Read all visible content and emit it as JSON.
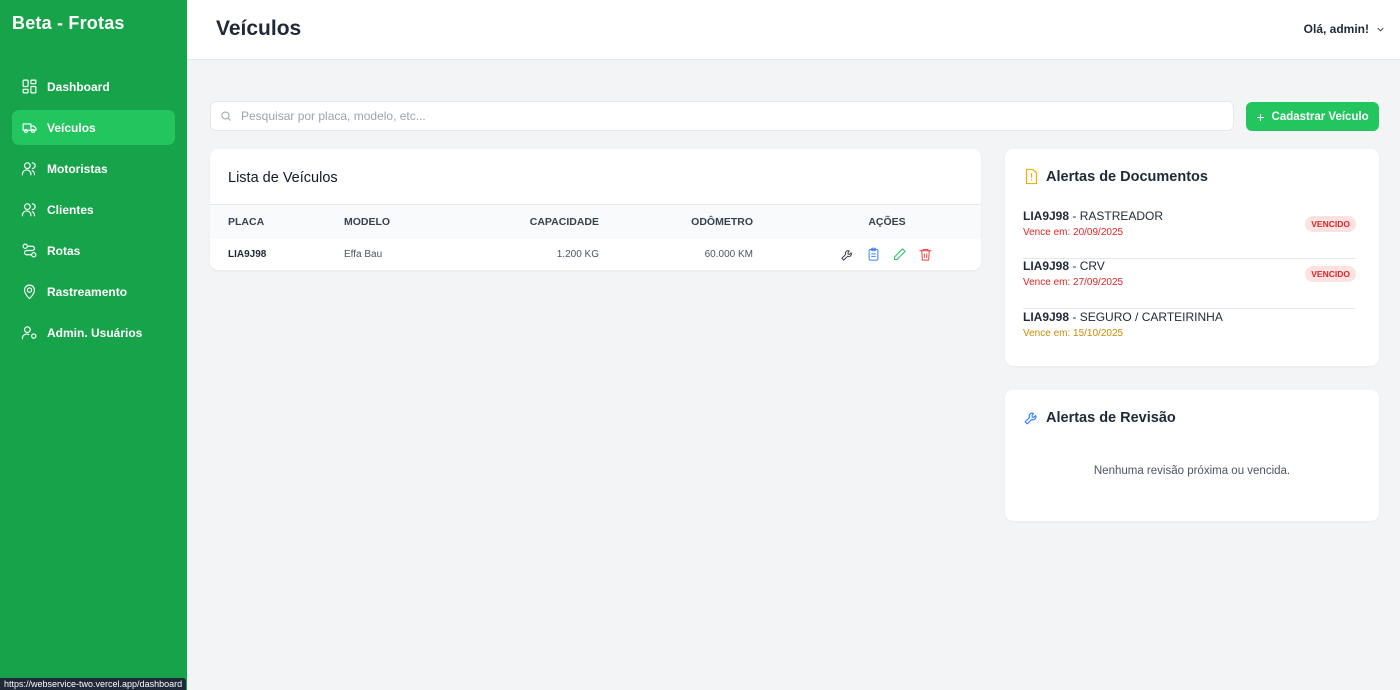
{
  "brand": "Beta - Frotas",
  "sidebar": {
    "items": [
      {
        "label": "Dashboard",
        "icon": "dashboard-icon"
      },
      {
        "label": "Veículos",
        "icon": "truck-icon",
        "active": true
      },
      {
        "label": "Motoristas",
        "icon": "users-icon"
      },
      {
        "label": "Clientes",
        "icon": "users-icon"
      },
      {
        "label": "Rotas",
        "icon": "route-icon"
      },
      {
        "label": "Rastreamento",
        "icon": "map-pin-icon"
      },
      {
        "label": "Admin. Usuários",
        "icon": "user-cog-icon"
      }
    ]
  },
  "status_url": "https://webservice-two.vercel.app/dashboard",
  "header": {
    "title": "Veículos",
    "user_greeting": "Olá, admin!"
  },
  "search": {
    "placeholder": "Pesquisar por placa, modelo, etc...",
    "value": ""
  },
  "add_button_label": "Cadastrar Veículo",
  "vehicle_list": {
    "title": "Lista de Veículos",
    "columns": [
      "PLACA",
      "MODELO",
      "CAPACIDADE",
      "ODÔMETRO",
      "AÇÕES"
    ],
    "rows": [
      {
        "placa": "LIA9J98",
        "modelo": "Effa Bau",
        "capacidade": "1.200 KG",
        "odometro": "60.000 KM"
      }
    ]
  },
  "document_alerts": {
    "title": "Alertas de Documentos",
    "items": [
      {
        "placa": "LIA9J98",
        "doc": " - RASTREADOR",
        "due": "Vence em: 20/09/2025",
        "status": "VENCIDO",
        "due_color": "#dc2626"
      },
      {
        "placa": "LIA9J98",
        "doc": " - CRV",
        "due": "Vence em: 27/09/2025",
        "status": "VENCIDO",
        "due_color": "#dc2626"
      },
      {
        "placa": "LIA9J98",
        "doc": " - SEGURO / CARTEIRINHA",
        "due": "Vence em: 15/10/2025",
        "status": "",
        "due_color": "#ca8a04"
      }
    ]
  },
  "revision_alerts": {
    "title": "Alertas de Revisão",
    "empty_message": "Nenhuma revisão próxima ou vencida."
  },
  "colors": {
    "sidebar_bg": "#16a34a",
    "accent": "#22c55e",
    "danger": "#dc2626",
    "warning": "#ca8a04",
    "info": "#3b82f6"
  }
}
